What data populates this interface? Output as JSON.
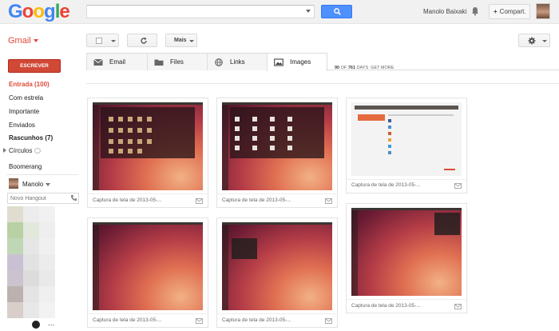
{
  "header": {
    "search_placeholder": "",
    "user_name": "Manolo Baixaki",
    "share_label": "Compart."
  },
  "nav": {
    "app_label": "Gmail",
    "compose_label": "ESCREVER",
    "items": [
      {
        "label": "Entrada (100)"
      },
      {
        "label": "Com estrela"
      },
      {
        "label": "Importante"
      },
      {
        "label": "Enviados"
      },
      {
        "label": "Rascunhos (7)"
      },
      {
        "label": "Círculos"
      },
      {
        "label": "Boomerang"
      }
    ],
    "chat_user": "Manolo",
    "hangout_placeholder": "Novo Hangout",
    "more_label": "..."
  },
  "toolbar": {
    "more_label": "Mais"
  },
  "tabs": [
    {
      "label": "Email",
      "icon": "envelope-icon"
    },
    {
      "label": "Files",
      "icon": "folder-icon"
    },
    {
      "label": "Links",
      "icon": "globe-icon"
    },
    {
      "label": "Images",
      "icon": "image-icon",
      "active": true
    }
  ],
  "tab_status": {
    "count": "90",
    "of_label": "OF",
    "total": "761",
    "days_label": "DAYS",
    "more_label": "GET MORE"
  },
  "images": [
    {
      "caption": "Captura de tela de 2013-05-...",
      "preview": "dash-apps"
    },
    {
      "caption": "Captura de tela de 2013-05-...",
      "preview": "dash-files"
    },
    {
      "caption": "Captura de tela de 2013-05-...",
      "preview": "settings-window"
    },
    {
      "caption": "Captura de tela de 2013-05-...",
      "preview": "desktop"
    },
    {
      "caption": "Captura de tela de 2013-05-...",
      "preview": "desktop-menu"
    },
    {
      "caption": "Captura de tela de 2013-05-...",
      "preview": "desktop-panel"
    }
  ],
  "colors": {
    "accent_red": "#dd4b39",
    "search_blue": "#4d90fe",
    "compose_red": "#d14836"
  }
}
